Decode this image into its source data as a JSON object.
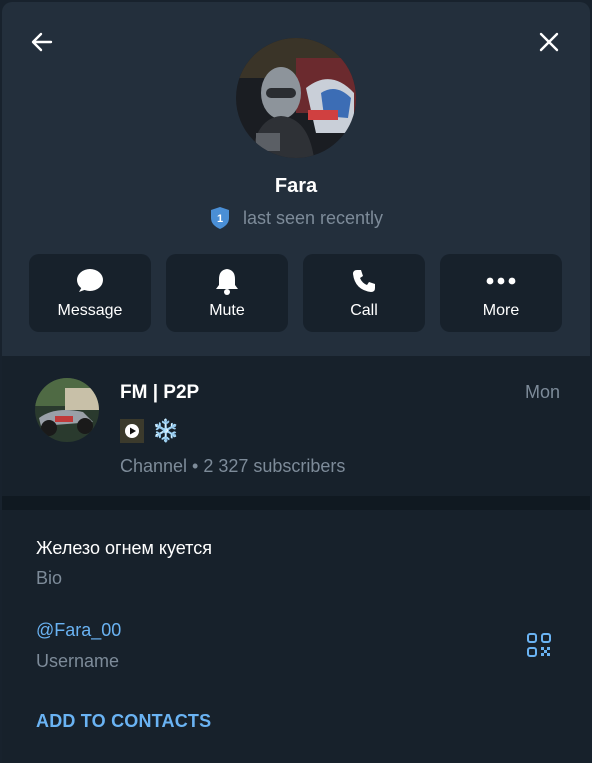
{
  "profile": {
    "name": "Fara",
    "status": "last seen recently",
    "badge_number": "1"
  },
  "actions": [
    {
      "label": "Message",
      "icon": "chat-bubble-icon"
    },
    {
      "label": "Mute",
      "icon": "bell-icon"
    },
    {
      "label": "Call",
      "icon": "phone-icon"
    },
    {
      "label": "More",
      "icon": "more-dots-icon"
    }
  ],
  "channel": {
    "name": "FM | P2P",
    "date": "Mon",
    "preview_emoji": "❄️",
    "subtitle": "Channel • 2 327 subscribers"
  },
  "info": {
    "bio": "Железо огнем куется",
    "bio_label": "Bio",
    "username": "@Fara_00",
    "username_label": "Username",
    "add_contact": "ADD TO CONTACTS"
  },
  "colors": {
    "accent": "#6ab3f3",
    "panel": "#17212b",
    "header": "#232f3c",
    "muted_text": "#7d8b99"
  }
}
